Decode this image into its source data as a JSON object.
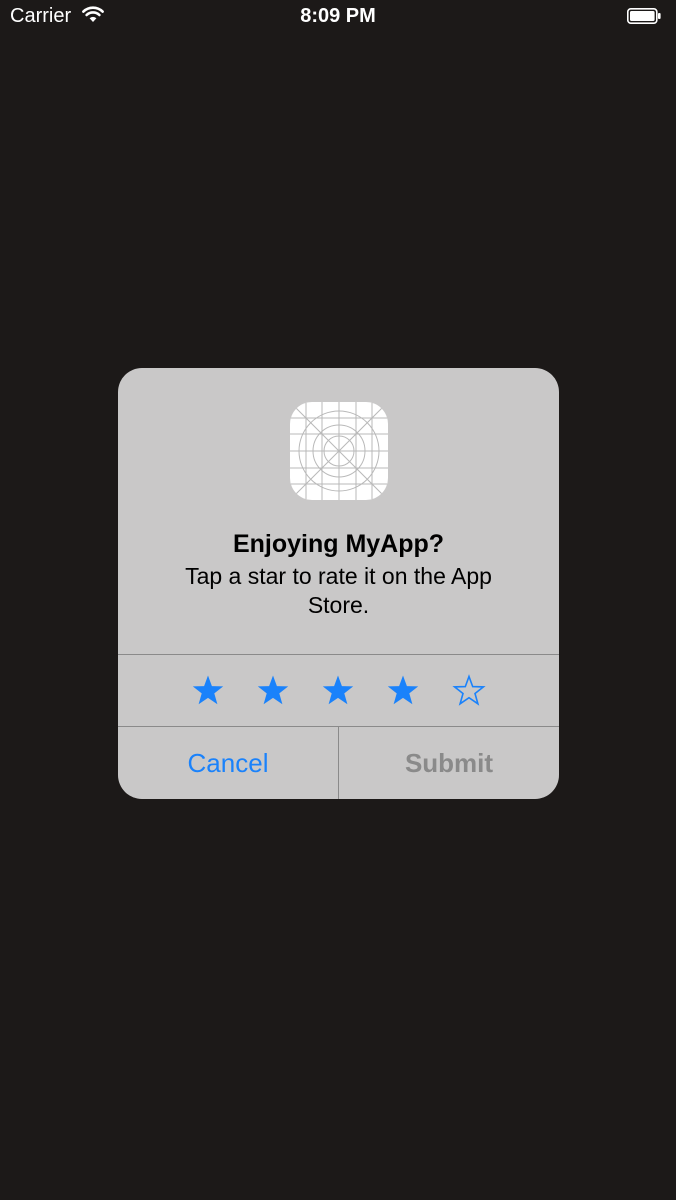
{
  "status_bar": {
    "carrier": "Carrier",
    "time": "8:09 PM",
    "wifi_icon": "wifi-icon",
    "battery_icon": "battery-icon"
  },
  "alert": {
    "app_icon": "app-icon-placeholder",
    "title": "Enjoying MyApp?",
    "message": "Tap a star to rate it on the App Store.",
    "rating": {
      "selected": 4,
      "max": 5
    },
    "buttons": {
      "cancel": "Cancel",
      "submit": "Submit"
    }
  },
  "colors": {
    "background": "#1c1918",
    "alert_background": "#c9c8c8",
    "accent": "#1a82fb",
    "disabled": "#8a8a8a"
  }
}
